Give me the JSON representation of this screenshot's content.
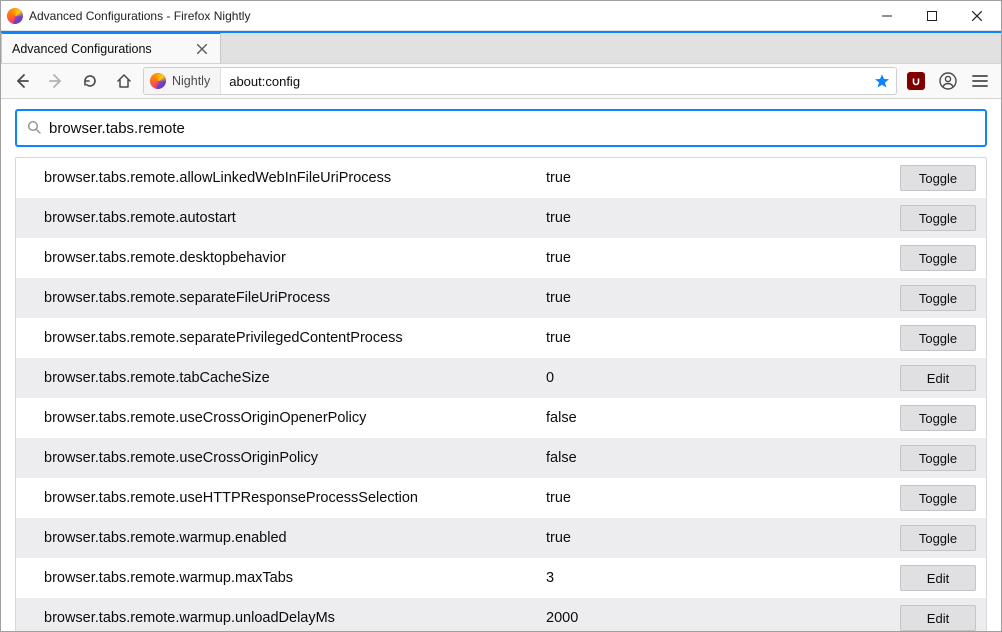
{
  "window": {
    "title": "Advanced Configurations - Firefox Nightly"
  },
  "tab": {
    "title": "Advanced Configurations"
  },
  "nav": {
    "identity_label": "Nightly",
    "url": "about:config"
  },
  "search": {
    "value": "browser.tabs.remote"
  },
  "buttons": {
    "toggle": "Toggle",
    "edit": "Edit"
  },
  "prefs": [
    {
      "name": "browser.tabs.remote.allowLinkedWebInFileUriProcess",
      "value": "true",
      "action": "toggle"
    },
    {
      "name": "browser.tabs.remote.autostart",
      "value": "true",
      "action": "toggle"
    },
    {
      "name": "browser.tabs.remote.desktopbehavior",
      "value": "true",
      "action": "toggle"
    },
    {
      "name": "browser.tabs.remote.separateFileUriProcess",
      "value": "true",
      "action": "toggle"
    },
    {
      "name": "browser.tabs.remote.separatePrivilegedContentProcess",
      "value": "true",
      "action": "toggle"
    },
    {
      "name": "browser.tabs.remote.tabCacheSize",
      "value": "0",
      "action": "edit"
    },
    {
      "name": "browser.tabs.remote.useCrossOriginOpenerPolicy",
      "value": "false",
      "action": "toggle"
    },
    {
      "name": "browser.tabs.remote.useCrossOriginPolicy",
      "value": "false",
      "action": "toggle"
    },
    {
      "name": "browser.tabs.remote.useHTTPResponseProcessSelection",
      "value": "true",
      "action": "toggle"
    },
    {
      "name": "browser.tabs.remote.warmup.enabled",
      "value": "true",
      "action": "toggle"
    },
    {
      "name": "browser.tabs.remote.warmup.maxTabs",
      "value": "3",
      "action": "edit"
    },
    {
      "name": "browser.tabs.remote.warmup.unloadDelayMs",
      "value": "2000",
      "action": "edit"
    }
  ]
}
